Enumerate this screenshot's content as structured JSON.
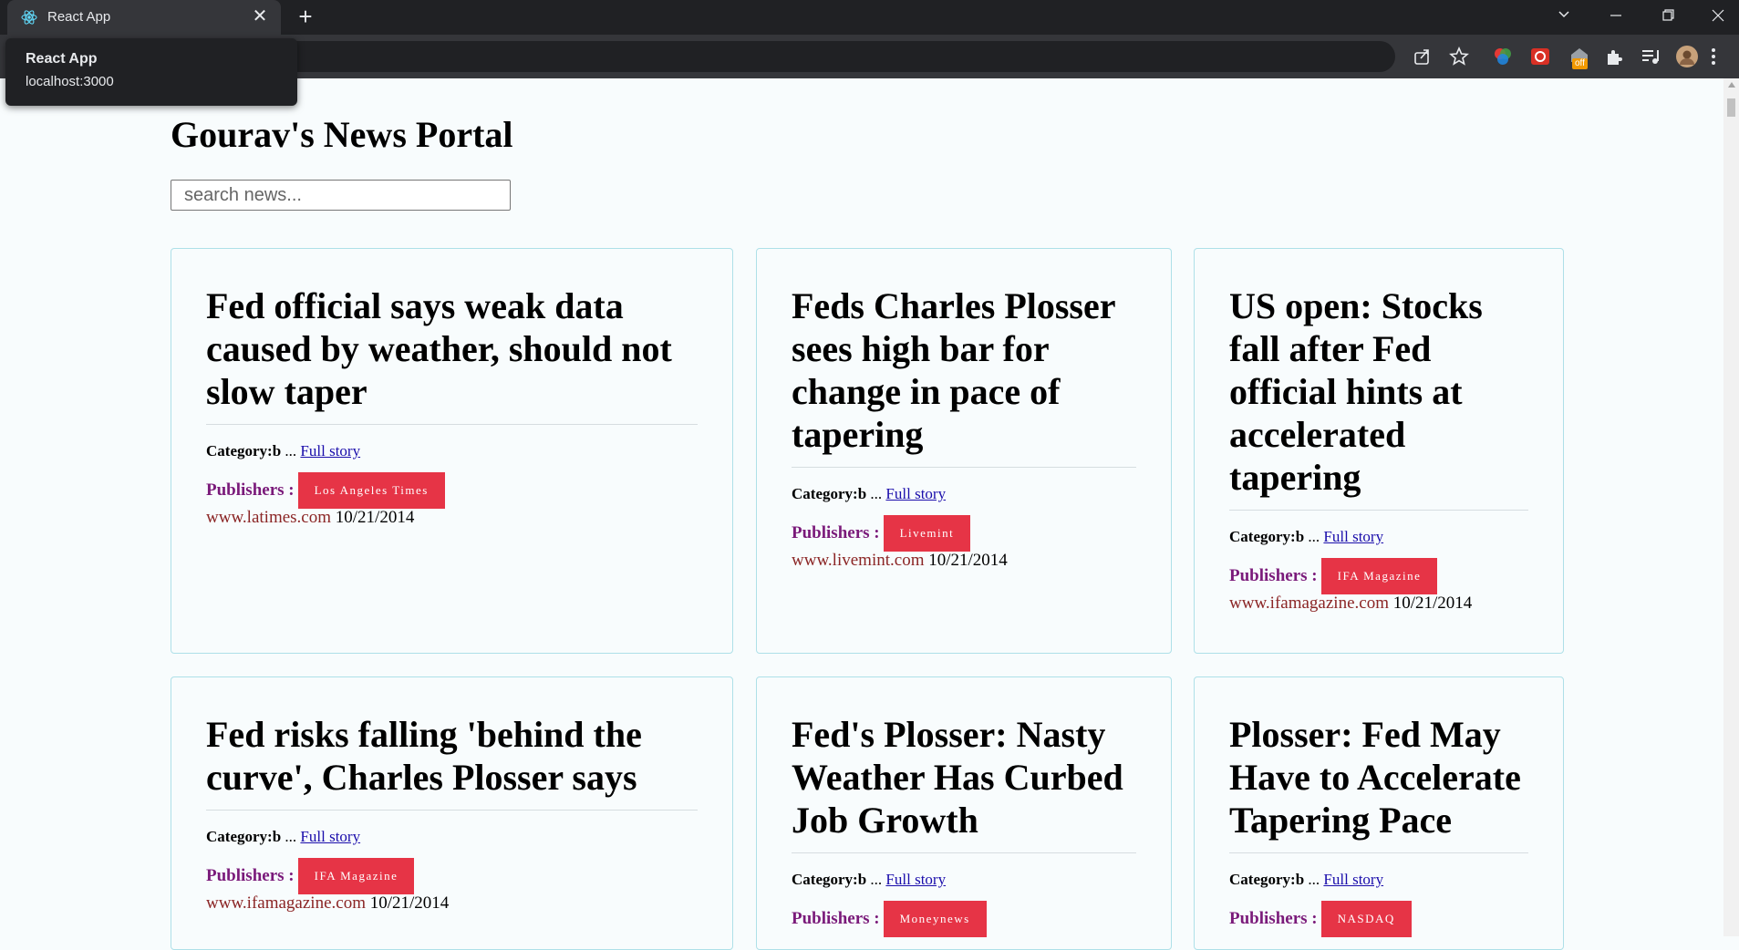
{
  "browser": {
    "tab_title": "React App",
    "tab_close": "✕",
    "new_tab": "+",
    "tooltip": {
      "title": "React App",
      "url": "localhost:3000"
    },
    "badge_text": "off"
  },
  "page": {
    "title": "Gourav's News Portal",
    "search_placeholder": "search news...",
    "search_value": ""
  },
  "labels": {
    "category_prefix": "Category:",
    "ellipsis": " ... ",
    "full_story": "Full story",
    "publishers": "Publishers :"
  },
  "articles": [
    {
      "title": "Fed official says weak data caused by weather, should not slow taper",
      "category": "b",
      "publisher": "Los Angeles Times",
      "url": "www.latimes.com",
      "date": "10/21/2014"
    },
    {
      "title": "Feds Charles Plosser sees high bar for change in pace of tapering",
      "category": "b",
      "publisher": "Livemint",
      "url": "www.livemint.com",
      "date": "10/21/2014"
    },
    {
      "title": "US open: Stocks fall after Fed official hints at accelerated tapering",
      "category": "b",
      "publisher": "IFA Magazine",
      "url": "www.ifamagazine.com",
      "date": "10/21/2014"
    },
    {
      "title": "Fed risks falling 'behind the curve', Charles Plosser says",
      "category": "b",
      "publisher": "IFA Magazine",
      "url": "www.ifamagazine.com",
      "date": "10/21/2014"
    },
    {
      "title": "Fed's Plosser: Nasty Weather Has Curbed Job Growth",
      "category": "b",
      "publisher": "Moneynews",
      "url": "",
      "date": ""
    },
    {
      "title": "Plosser: Fed May Have to Accelerate Tapering Pace",
      "category": "b",
      "publisher": "NASDAQ",
      "url": "",
      "date": ""
    }
  ],
  "colors": {
    "badge": "#e63446",
    "publisher_label": "#7a1a7a",
    "source_url": "#8b2525",
    "card_border": "#aee0e8"
  }
}
